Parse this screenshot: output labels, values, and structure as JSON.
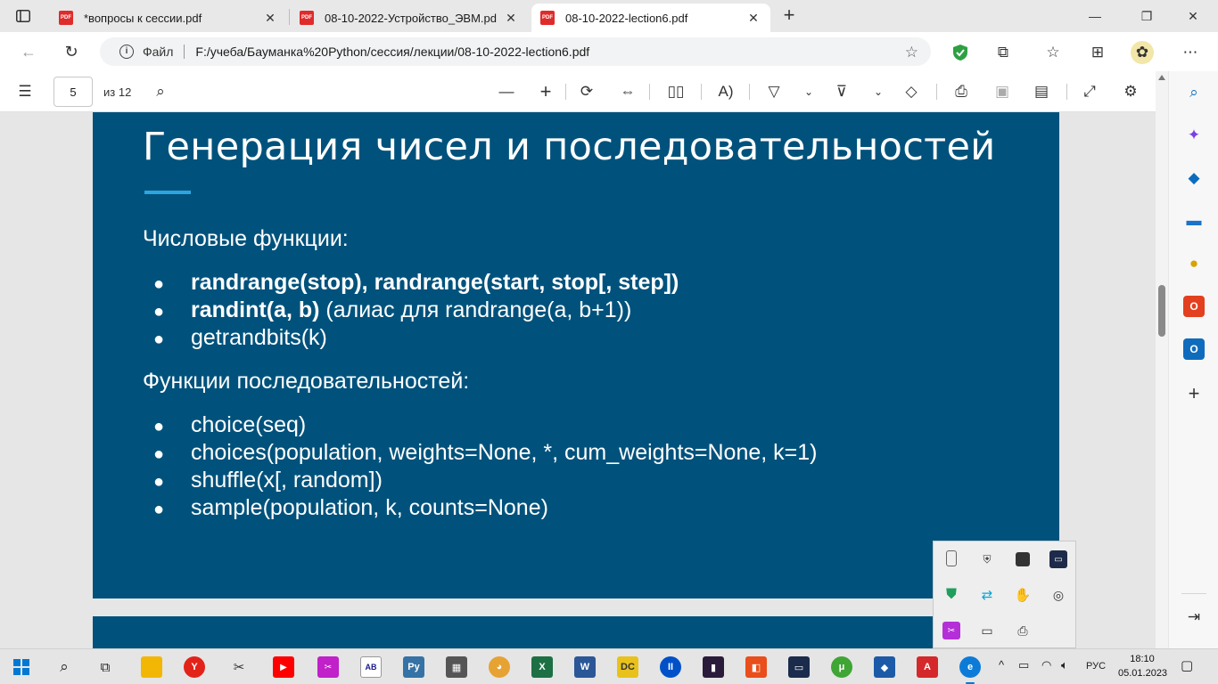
{
  "tabs": [
    {
      "title": "*вопросы к сессии.pdf",
      "icon": "PDF"
    },
    {
      "title": "08-10-2022-Устройство_ЭВМ.pd",
      "icon": "PDF"
    },
    {
      "title": "08-10-2022-lection6.pdf",
      "icon": "PDF"
    }
  ],
  "address": {
    "site_label": "Файл",
    "url": "F:/учеба/Бауманка%20Python/сессия/лекции/08-10-2022-lection6.pdf"
  },
  "pdf_toolbar": {
    "page_current": "5",
    "page_total": "из 12"
  },
  "slide": {
    "title": "Генерация чисел и последовательностей",
    "section1": "Числовые функции:",
    "b1_bold": "randrange(stop), randrange(start, stop[, step])",
    "b2_bold": "randint(a, b)",
    "b2_rest": " (алиас для randrange(a, b+1))",
    "b3": "getrandbits(k)",
    "section2": "Функции последовательностей:",
    "b4": "choice(seq)",
    "b5": "choices(population, weights=None, *, cum_weights=None, k=1)",
    "b6": "shuffle(x[, random])",
    "b7": "sample(population, k, counts=None)",
    "bullet_char": "●"
  },
  "taskbar": {
    "lang": "РУС",
    "time": "18:10",
    "date": "05.01.2023"
  },
  "colors": {
    "slide_bg": "#00527c",
    "accent_rule": "#2ea4de"
  }
}
